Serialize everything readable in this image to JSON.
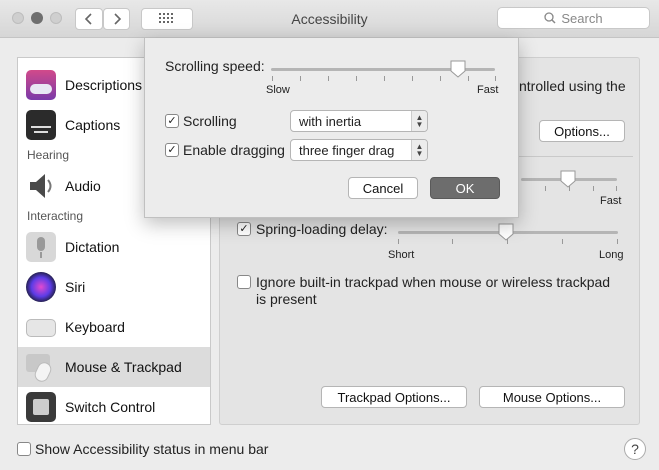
{
  "window": {
    "title": "Accessibility"
  },
  "search": {
    "placeholder": "Search"
  },
  "sidebar": {
    "items": [
      {
        "label": "Descriptions"
      },
      {
        "label": "Captions"
      },
      {
        "label": "Audio"
      },
      {
        "label": "Dictation"
      },
      {
        "label": "Siri"
      },
      {
        "label": "Keyboard"
      },
      {
        "label": "Mouse & Trackpad"
      },
      {
        "label": "Switch Control"
      }
    ],
    "headers": {
      "hearing": "Hearing",
      "interacting": "Interacting"
    },
    "selected": "Mouse & Trackpad"
  },
  "pane": {
    "partial_text": "ntrolled using the",
    "options_button": "Options...",
    "double_click_slider": {
      "right_label": "Fast"
    },
    "spring_loading": {
      "label": "Spring-loading delay:",
      "checked": true,
      "min_label": "Short",
      "max_label": "Long"
    },
    "ignore_trackpad": {
      "label_line1": "Ignore built-in trackpad when mouse or wireless trackpad",
      "label_line2": "is present",
      "checked": false
    },
    "trackpad_options_button": "Trackpad Options...",
    "mouse_options_button": "Mouse Options..."
  },
  "sheet": {
    "scrolling_speed": {
      "label": "Scrolling speed:",
      "min_label": "Slow",
      "max_label": "Fast"
    },
    "scrolling": {
      "label": "Scrolling",
      "checked": true,
      "value": "with inertia"
    },
    "dragging": {
      "label": "Enable dragging",
      "checked": true,
      "value": "three finger drag"
    },
    "cancel_button": "Cancel",
    "ok_button": "OK"
  },
  "footer": {
    "status_checkbox": {
      "label": "Show Accessibility status in menu bar",
      "checked": false
    },
    "help_label": "?"
  },
  "colors": {
    "ok_button_bg": "#6d6d6d",
    "selected_row": "#dcdcdc"
  }
}
